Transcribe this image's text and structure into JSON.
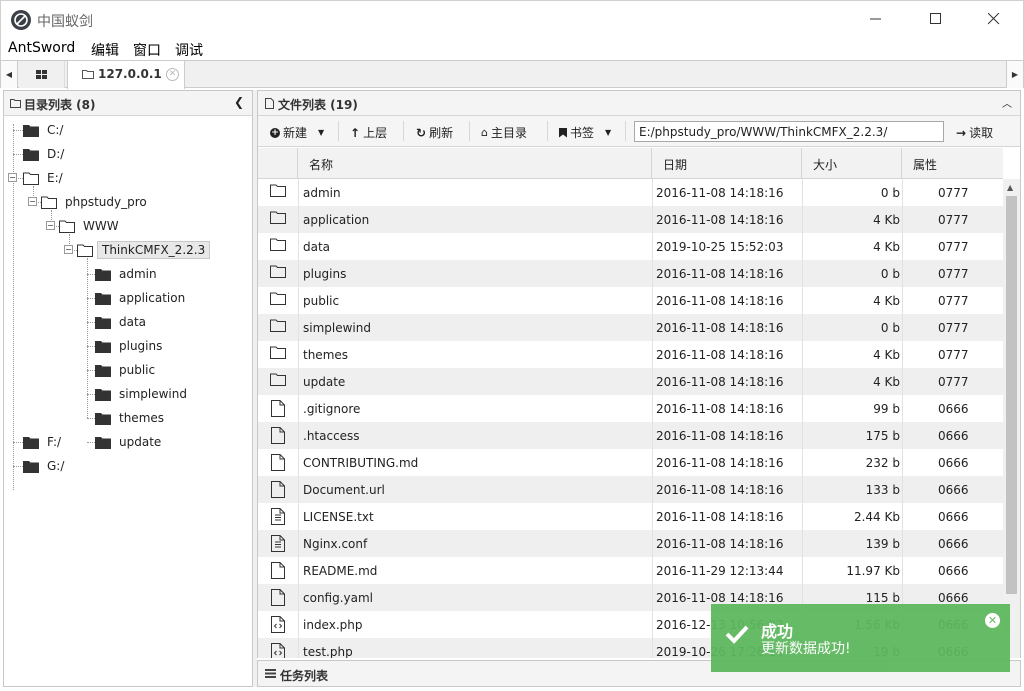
{
  "window": {
    "title": "中国蚁剑"
  },
  "menu": [
    "AntSword",
    "编辑",
    "窗口",
    "调试"
  ],
  "tabs": {
    "active_label": "127.0.0.1"
  },
  "left_panel": {
    "title": "目录列表 (8)",
    "tree": {
      "drives_top": [
        "C:/",
        "D:/",
        "E:/"
      ],
      "phpstudy": "phpstudy_pro",
      "www": "WWW",
      "project": "ThinkCMFX_2.2.3",
      "children": [
        "admin",
        "application",
        "data",
        "plugins",
        "public",
        "simplewind",
        "themes",
        "update"
      ],
      "drives_bottom": [
        "F:/",
        "G:/"
      ]
    }
  },
  "right_panel": {
    "title": "文件列表 (19)",
    "toolbar": {
      "new": "新建",
      "up": "上层",
      "refresh": "刷新",
      "home": "主目录",
      "bookmark": "书签",
      "path": "E:/phpstudy_pro/WWW/ThinkCMFX_2.2.3/",
      "read": "读取"
    },
    "columns": [
      "名称",
      "日期",
      "大小",
      "属性"
    ],
    "rows": [
      {
        "icon": "folder",
        "name": "admin",
        "date": "2016-11-08 14:18:16",
        "size": "0 b",
        "attr": "0777"
      },
      {
        "icon": "folder",
        "name": "application",
        "date": "2016-11-08 14:18:16",
        "size": "4 Kb",
        "attr": "0777"
      },
      {
        "icon": "folder",
        "name": "data",
        "date": "2019-10-25 15:52:03",
        "size": "4 Kb",
        "attr": "0777"
      },
      {
        "icon": "folder",
        "name": "plugins",
        "date": "2016-11-08 14:18:16",
        "size": "0 b",
        "attr": "0777"
      },
      {
        "icon": "folder",
        "name": "public",
        "date": "2016-11-08 14:18:16",
        "size": "4 Kb",
        "attr": "0777"
      },
      {
        "icon": "folder",
        "name": "simplewind",
        "date": "2016-11-08 14:18:16",
        "size": "0 b",
        "attr": "0777"
      },
      {
        "icon": "folder",
        "name": "themes",
        "date": "2016-11-08 14:18:16",
        "size": "4 Kb",
        "attr": "0777"
      },
      {
        "icon": "folder",
        "name": "update",
        "date": "2016-11-08 14:18:16",
        "size": "4 Kb",
        "attr": "0777"
      },
      {
        "icon": "file",
        "name": ".gitignore",
        "date": "2016-11-08 14:18:16",
        "size": "99 b",
        "attr": "0666"
      },
      {
        "icon": "file",
        "name": ".htaccess",
        "date": "2016-11-08 14:18:16",
        "size": "175 b",
        "attr": "0666"
      },
      {
        "icon": "file",
        "name": "CONTRIBUTING.md",
        "date": "2016-11-08 14:18:16",
        "size": "232 b",
        "attr": "0666"
      },
      {
        "icon": "file",
        "name": "Document.url",
        "date": "2016-11-08 14:18:16",
        "size": "133 b",
        "attr": "0666"
      },
      {
        "icon": "file-text",
        "name": "LICENSE.txt",
        "date": "2016-11-08 14:18:16",
        "size": "2.44 Kb",
        "attr": "0666"
      },
      {
        "icon": "file-text",
        "name": "Nginx.conf",
        "date": "2016-11-08 14:18:16",
        "size": "139 b",
        "attr": "0666"
      },
      {
        "icon": "file",
        "name": "README.md",
        "date": "2016-11-29 12:13:44",
        "size": "11.97 Kb",
        "attr": "0666"
      },
      {
        "icon": "file",
        "name": "config.yaml",
        "date": "2016-11-08 14:18:16",
        "size": "115 b",
        "attr": "0666"
      },
      {
        "icon": "file-code",
        "name": "index.php",
        "date": "2016-12-13 10:56:32",
        "size": "1.56 Kb",
        "attr": "0666"
      },
      {
        "icon": "file-code",
        "name": "test.php",
        "date": "2019-10-26 17:26:14",
        "size": "19 b",
        "attr": "0666"
      }
    ]
  },
  "task_bar": {
    "title": "任务列表"
  },
  "toast": {
    "title": "成功",
    "message": "更新数据成功!",
    "color": "#5eb85e"
  }
}
